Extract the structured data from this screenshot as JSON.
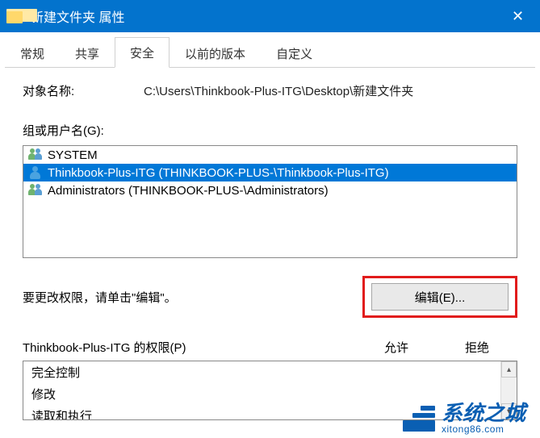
{
  "titlebar": {
    "title": "新建文件夹 属性",
    "close_glyph": "✕"
  },
  "tabs": [
    {
      "label": "常规",
      "active": false
    },
    {
      "label": "共享",
      "active": false
    },
    {
      "label": "安全",
      "active": true
    },
    {
      "label": "以前的版本",
      "active": false
    },
    {
      "label": "自定义",
      "active": false
    }
  ],
  "object": {
    "label": "对象名称:",
    "value": "C:\\Users\\Thinkbook-Plus-ITG\\Desktop\\新建文件夹"
  },
  "groups": {
    "label": "组或用户名(G):",
    "items": [
      {
        "icon": "group",
        "text": "SYSTEM",
        "selected": false
      },
      {
        "icon": "user",
        "text": "Thinkbook-Plus-ITG (THINKBOOK-PLUS-\\Thinkbook-Plus-ITG)",
        "selected": true
      },
      {
        "icon": "group",
        "text": "Administrators (THINKBOOK-PLUS-\\Administrators)",
        "selected": false
      }
    ]
  },
  "edit": {
    "hint": "要更改权限，请单击\"编辑\"。",
    "button_label": "编辑(E)..."
  },
  "permissions": {
    "header_label": "Thinkbook-Plus-ITG 的权限(P)",
    "col_allow": "允许",
    "col_deny": "拒绝",
    "rows": [
      {
        "name": "完全控制"
      },
      {
        "name": "修改"
      },
      {
        "name": "读取和执行"
      }
    ]
  },
  "watermark": {
    "cn": "系统之城",
    "en": "xitong86.com"
  }
}
